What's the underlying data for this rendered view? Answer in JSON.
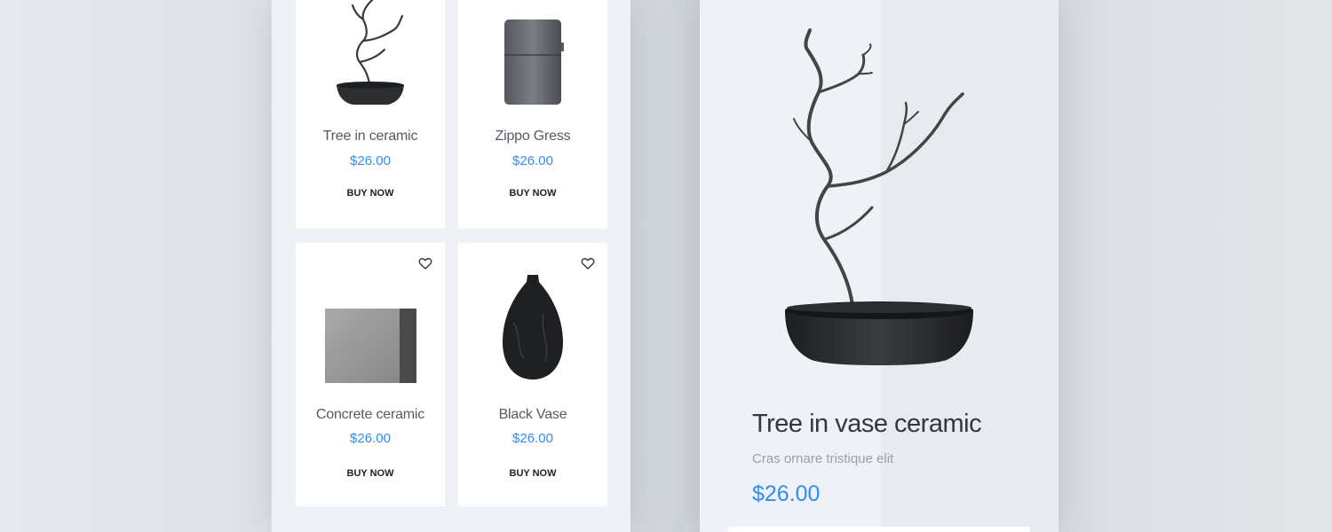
{
  "products": [
    {
      "name": "Tree in ceramic",
      "price": "$26.00",
      "cta": "BUY NOW",
      "icon": "tree-in-pot-image"
    },
    {
      "name": "Zippo Gress",
      "price": "$26.00",
      "cta": "BUY NOW",
      "icon": "lighter-image"
    },
    {
      "name": "Concrete ceramic",
      "price": "$26.00",
      "cta": "BUY NOW",
      "icon": "concrete-block-image"
    },
    {
      "name": "Black Vase",
      "price": "$26.00",
      "cta": "BUY NOW",
      "icon": "black-vase-image"
    }
  ],
  "detail": {
    "title": "Tree in vase ceramic",
    "subtitle": "Cras ornare tristique elit",
    "price": "$26.00",
    "icon": "tree-in-pot-image"
  },
  "colors": {
    "accent": "#2f8ef5",
    "card": "#ffffff",
    "panel": "#eef1f5"
  }
}
